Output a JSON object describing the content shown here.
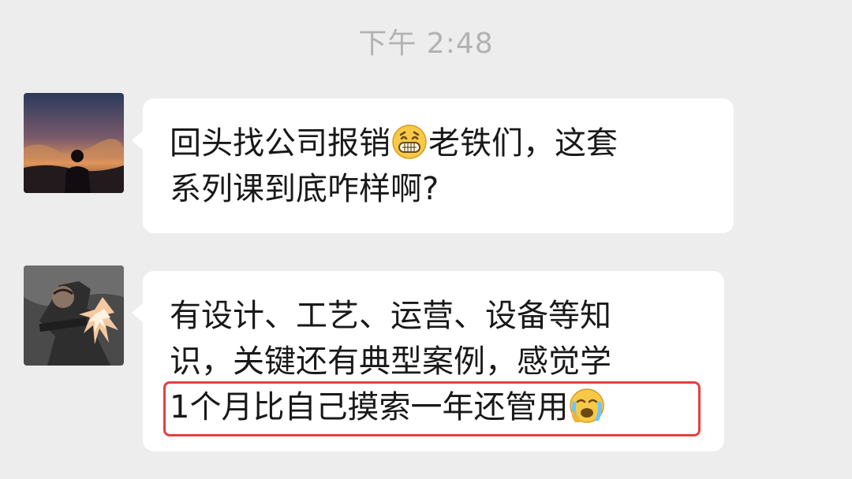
{
  "timestamp": "下午 2:48",
  "messages": [
    {
      "avatar": "sunset-silhouette-avatar",
      "lines": [
        {
          "before": "回头找公司报销",
          "emoji": "grinning-face-emoji",
          "after": "老铁们，这套"
        },
        {
          "text": "系列课到底咋样啊?"
        }
      ]
    },
    {
      "avatar": "game-character-avatar",
      "lines": [
        {
          "text": "有设计、工艺、运营、设备等知"
        },
        {
          "text": "识，关键还有典型案例，感觉学"
        },
        {
          "text": "1个月比自己摸索一年还管用",
          "emoji": "crying-face-emoji",
          "highlighted": true
        }
      ]
    }
  ],
  "colors": {
    "background": "#ededed",
    "bubble": "#ffffff",
    "text": "#191919",
    "timestamp": "#b2b2b2",
    "highlight_border": "#e34040"
  }
}
